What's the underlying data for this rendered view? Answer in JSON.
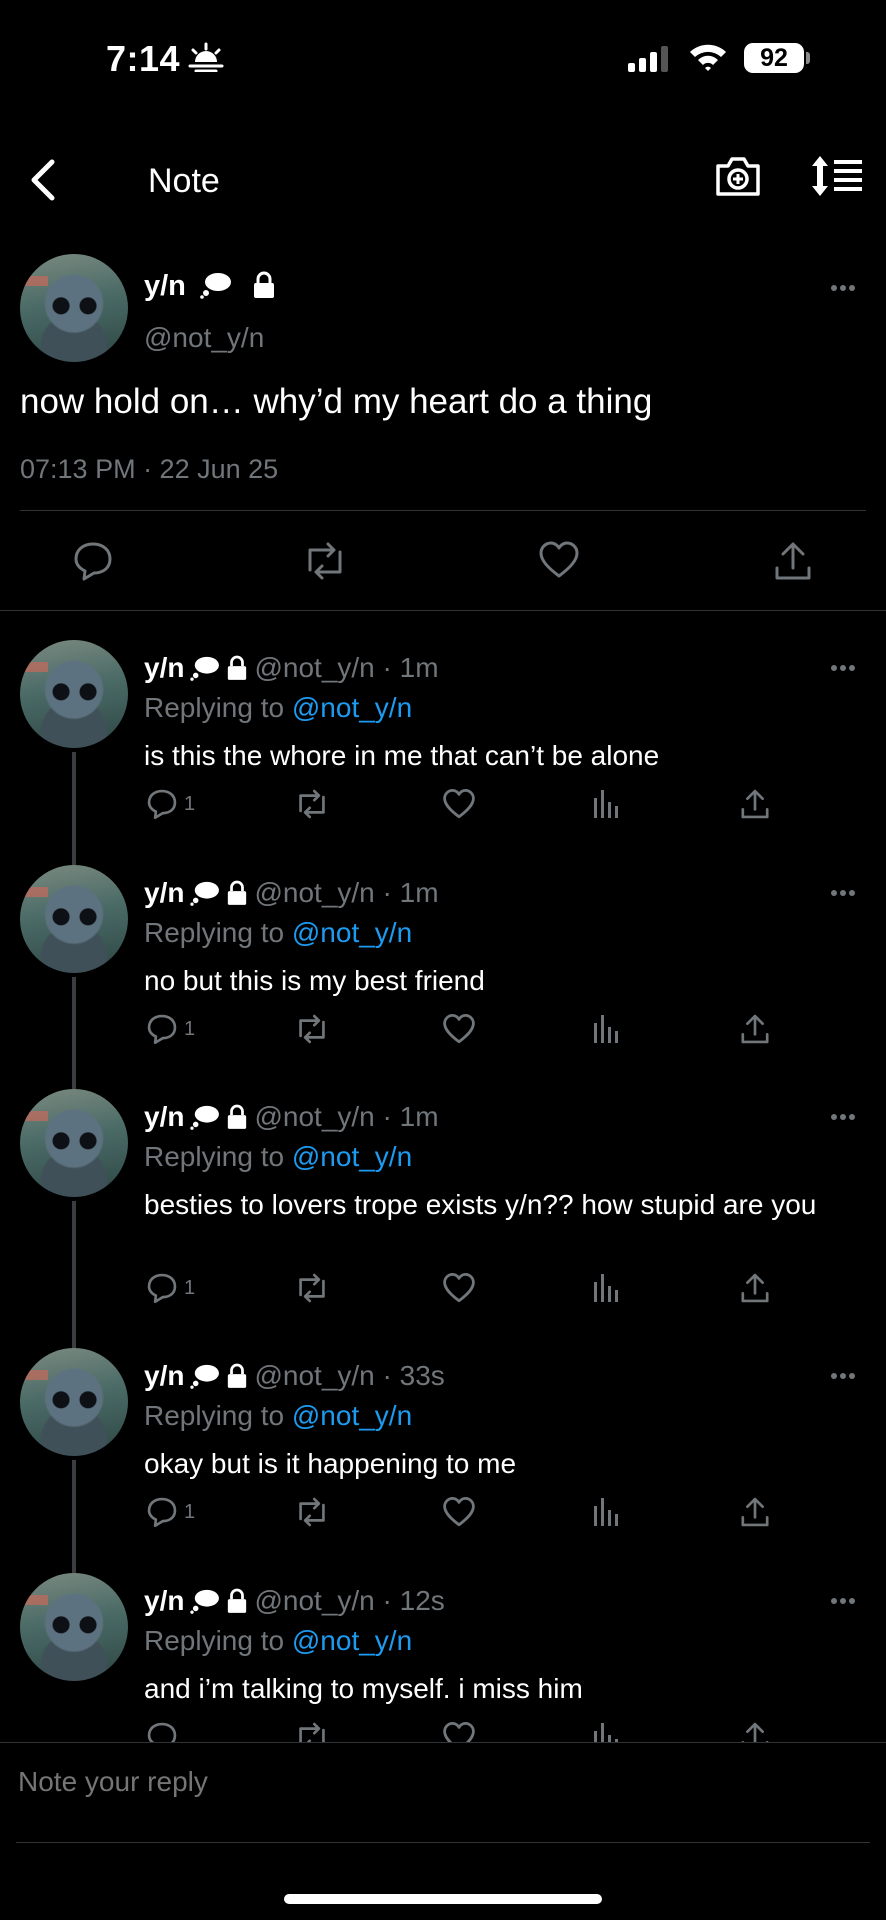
{
  "status_bar": {
    "time": "7:14",
    "battery": "92"
  },
  "nav": {
    "title": "Note"
  },
  "main_tweet": {
    "name": "y/n",
    "handle": "@not_y/n",
    "text": "now hold on… why’d my heart do a thing",
    "timestamp": "07:13 PM · 22 Jun 25"
  },
  "replies": [
    {
      "name": "y/n",
      "meta": "@not_y/n · 1m",
      "replying_prefix": "Replying to ",
      "replying_to": "@not_y/n",
      "text": "is this the whore in me that can’t be alone",
      "reply_count": "1"
    },
    {
      "name": "y/n",
      "meta": "@not_y/n · 1m",
      "replying_prefix": "Replying to ",
      "replying_to": "@not_y/n",
      "text": "no but this is my best friend",
      "reply_count": "1"
    },
    {
      "name": "y/n",
      "meta": "@not_y/n · 1m",
      "replying_prefix": "Replying to ",
      "replying_to": "@not_y/n",
      "text": "besties to lovers trope exists y/n?? how stupid are you",
      "reply_count": "1"
    },
    {
      "name": "y/n",
      "meta": "@not_y/n · 33s",
      "replying_prefix": "Replying to ",
      "replying_to": "@not_y/n",
      "text": "okay but is it happening to me",
      "reply_count": "1"
    },
    {
      "name": "y/n",
      "meta": "@not_y/n · 12s",
      "replying_prefix": "Replying to ",
      "replying_to": "@not_y/n",
      "text": "and i’m talking to myself. i miss him",
      "reply_count": ""
    }
  ],
  "reply_bar": {
    "placeholder": "Note your reply"
  },
  "colors": {
    "background": "#000000",
    "text": "#ffffff",
    "muted": "#71767b",
    "link": "#1d9bf0",
    "divider": "#2f3336"
  },
  "icons": [
    "back-icon",
    "camera-plus-icon",
    "sort-icon",
    "thought-bubble-icon",
    "lock-icon",
    "more-icon",
    "comment-icon",
    "retweet-icon",
    "heart-icon",
    "views-icon",
    "share-icon"
  ]
}
